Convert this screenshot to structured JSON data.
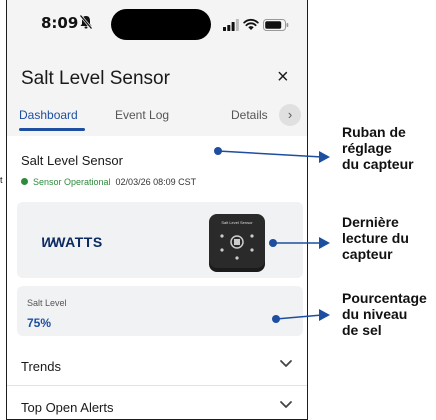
{
  "status_bar": {
    "time": "8:09",
    "icons": [
      "bell-mute-icon",
      "signal-icon",
      "wifi-icon",
      "battery-icon"
    ]
  },
  "header": {
    "title": "Salt Level Sensor",
    "close_label": "×"
  },
  "tabs": [
    {
      "label": "Dashboard",
      "active": true
    },
    {
      "label": "Event Log",
      "active": false
    },
    {
      "label": "Details",
      "active": false
    }
  ],
  "tabs_next_label": "›",
  "sensor": {
    "title": "Salt Level Sensor",
    "status": "Sensor Operational",
    "timestamp": "02/03/26 08:09 CST"
  },
  "brand": {
    "logo_text": "WATTS",
    "logo_mark": "W"
  },
  "device_label": "Salt Level Sensor",
  "salt": {
    "label": "Salt Level",
    "value": "75%"
  },
  "sections": [
    {
      "label": "Trends"
    },
    {
      "label": "Top Open Alerts"
    }
  ],
  "annotations": [
    {
      "line1": "Ruban de",
      "line2": "réglage",
      "line3": "du capteur"
    },
    {
      "line1": "Dernière",
      "line2": "lecture du",
      "line3": "capteur"
    },
    {
      "line1": "Pourcentage",
      "line2": "du niveau",
      "line3": "de sel"
    }
  ],
  "edge_text": "t",
  "colors": {
    "accent": "#1d4e9f",
    "status_ok": "#2e8b3c",
    "card_bg": "#f0f2f4",
    "brand": "#0b2a62"
  }
}
